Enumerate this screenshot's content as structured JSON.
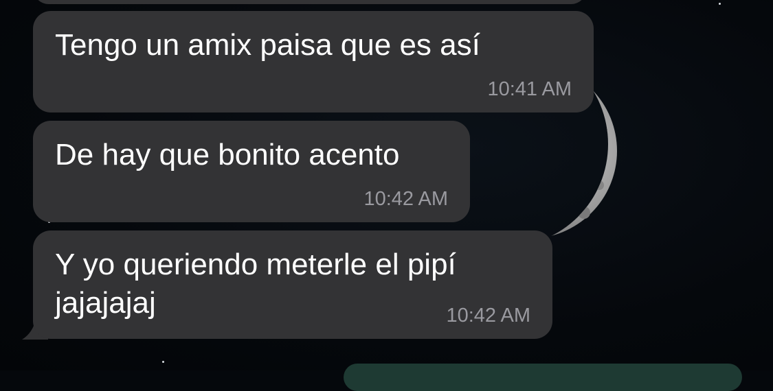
{
  "chat": {
    "messages": [
      {
        "text": "Tengo un amix paisa que es así",
        "time": "10:41 AM"
      },
      {
        "text": "De hay que bonito acento",
        "time": "10:42 AM"
      },
      {
        "text": "Y yo queriendo meterle el pipí jajajajaj",
        "time": "10:42 AM"
      }
    ]
  },
  "colors": {
    "incoming_bubble": "#333335",
    "outgoing_bubble": "#1e3a33",
    "timestamp": "#9a9aa0",
    "message_text": "#ffffff",
    "background": "#05080c"
  },
  "icons": {
    "wallpaper": "crescent-moon-icon"
  }
}
